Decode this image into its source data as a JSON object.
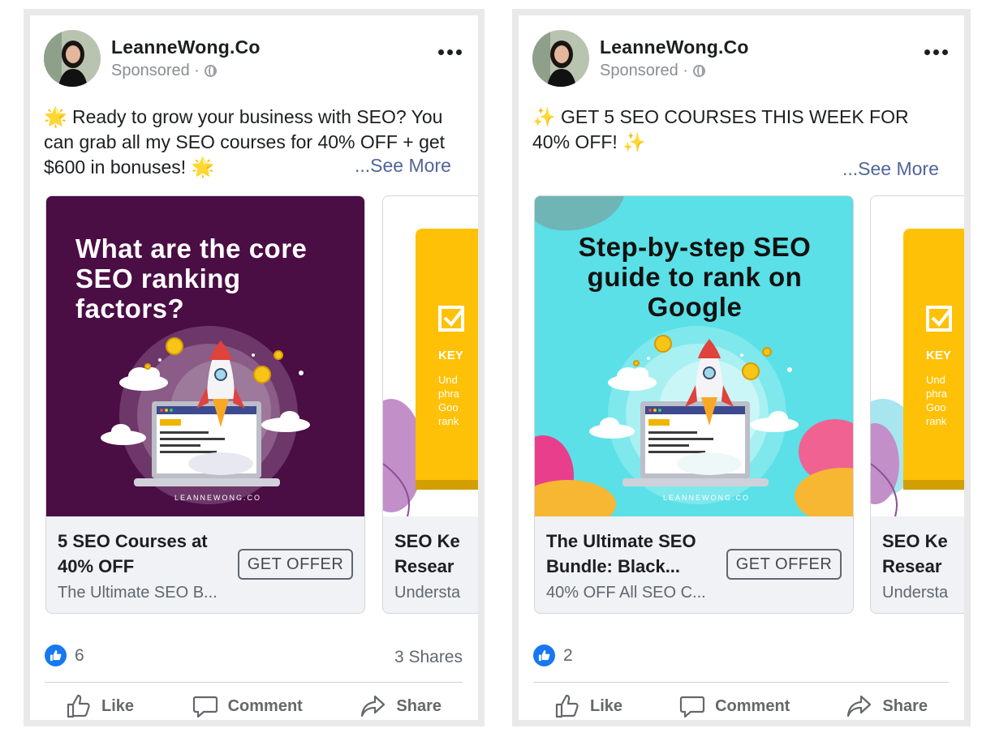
{
  "posts": [
    {
      "author": "LeanneWong.Co",
      "sponsored": "Sponsored ·",
      "caption": "🌟 Ready to grow your business with SEO? You can grab all my SEO courses for 40% OFF + get $600 in bonuses! 🌟",
      "see_more": "...See More",
      "cards": [
        {
          "image_title": "What are the core SEO ranking factors?",
          "brand": "LEANNEWONG.CO",
          "title": "5 SEO Courses at 40% OFF",
          "subtitle": "The Ultimate SEO B...",
          "button": "GET OFFER",
          "bg_color": "#4a0d44"
        },
        {
          "image_heading": "KEY",
          "image_text": "Und phra Goo rank",
          "title": "SEO Ke Resear",
          "subtitle": "Understa"
        }
      ],
      "like_count": "6",
      "shares": "3 Shares",
      "actions": {
        "like": "Like",
        "comment": "Comment",
        "share": "Share"
      }
    },
    {
      "author": "LeanneWong.Co",
      "sponsored": "Sponsored ·",
      "caption": "✨ GET 5 SEO COURSES THIS WEEK FOR 40% OFF! ✨",
      "see_more": "...See More",
      "cards": [
        {
          "image_title": "Step-by-step SEO guide to rank on Google",
          "brand": "LEANNEWONG.CO",
          "title": "The Ultimate SEO Bundle: Black...",
          "subtitle": "40% OFF All SEO C...",
          "button": "GET OFFER",
          "bg_color": "#5ae0e6"
        },
        {
          "image_heading": "KEY",
          "image_text": "Und phra Goo rank",
          "title": "SEO Ke Resear",
          "subtitle": "Understa"
        }
      ],
      "like_count": "2",
      "shares": "",
      "actions": {
        "like": "Like",
        "comment": "Comment",
        "share": "Share"
      }
    }
  ],
  "colors": {
    "link": "#50649a",
    "like_blue": "#1877f2",
    "card_yellow": "#ffc107",
    "purple_bg": "#4a0d44",
    "cyan_bg": "#5ae0e6"
  }
}
